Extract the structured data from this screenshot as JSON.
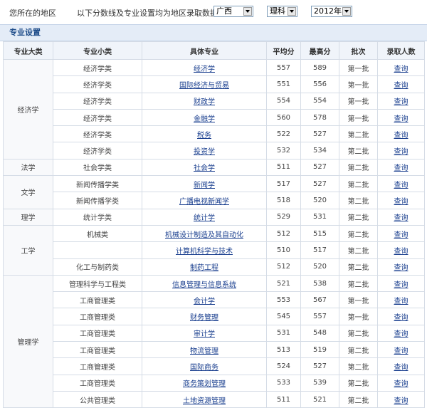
{
  "filters": {
    "region_label": "您所在的地区",
    "desc_label": "以下分数线及专业设置均为地区录取数据",
    "region": "广西",
    "type": "理科",
    "year": "2012年"
  },
  "section_title": "专业设置",
  "columns": [
    "专业大类",
    "专业小类",
    "具体专业",
    "平均分",
    "最高分",
    "批次",
    "录取人数"
  ],
  "groups": [
    {
      "name": "经济学",
      "rows": [
        {
          "sub": "经济学类",
          "major": "经济学",
          "avg": "557",
          "max": "589",
          "batch": "第一批",
          "query": "查询"
        },
        {
          "sub": "经济学类",
          "major": "国际经济与贸易",
          "avg": "551",
          "max": "556",
          "batch": "第一批",
          "query": "查询"
        },
        {
          "sub": "经济学类",
          "major": "财政学",
          "avg": "554",
          "max": "554",
          "batch": "第一批",
          "query": "查询"
        },
        {
          "sub": "经济学类",
          "major": "金融学",
          "avg": "560",
          "max": "578",
          "batch": "第一批",
          "query": "查询"
        },
        {
          "sub": "经济学类",
          "major": "税务",
          "avg": "522",
          "max": "527",
          "batch": "第二批",
          "query": "查询"
        },
        {
          "sub": "经济学类",
          "major": "投资学",
          "avg": "532",
          "max": "534",
          "batch": "第二批",
          "query": "查询"
        }
      ]
    },
    {
      "name": "法学",
      "rows": [
        {
          "sub": "社会学类",
          "major": "社会学",
          "avg": "511",
          "max": "527",
          "batch": "第二批",
          "query": "查询"
        }
      ]
    },
    {
      "name": "文学",
      "rows": [
        {
          "sub": "新闻传播学类",
          "major": "新闻学",
          "avg": "517",
          "max": "527",
          "batch": "第二批",
          "query": "查询"
        },
        {
          "sub": "新闻传播学类",
          "major": "广播电视新闻学",
          "avg": "518",
          "max": "520",
          "batch": "第二批",
          "query": "查询"
        }
      ]
    },
    {
      "name": "理学",
      "rows": [
        {
          "sub": "统计学类",
          "major": "统计学",
          "avg": "529",
          "max": "531",
          "batch": "第二批",
          "query": "查询"
        }
      ]
    },
    {
      "name": "工学",
      "rows": [
        {
          "sub": "机械类",
          "major": "机械设计制造及其自动化",
          "avg": "512",
          "max": "515",
          "batch": "第二批",
          "query": "查询"
        },
        {
          "sub": "",
          "major": "计算机科学与技术",
          "avg": "510",
          "max": "517",
          "batch": "第二批",
          "query": "查询"
        },
        {
          "sub": "化工与制药类",
          "major": "制药工程",
          "avg": "512",
          "max": "520",
          "batch": "第二批",
          "query": "查询"
        }
      ]
    },
    {
      "name": "管理学",
      "rows": [
        {
          "sub": "管理科学与工程类",
          "major": "信息管理与信息系统",
          "avg": "521",
          "max": "538",
          "batch": "第二批",
          "query": "查询"
        },
        {
          "sub": "工商管理类",
          "major": "会计学",
          "avg": "553",
          "max": "567",
          "batch": "第一批",
          "query": "查询"
        },
        {
          "sub": "工商管理类",
          "major": "财务管理",
          "avg": "545",
          "max": "557",
          "batch": "第一批",
          "query": "查询"
        },
        {
          "sub": "工商管理类",
          "major": "审计学",
          "avg": "531",
          "max": "548",
          "batch": "第二批",
          "query": "查询"
        },
        {
          "sub": "工商管理类",
          "major": "物流管理",
          "avg": "513",
          "max": "519",
          "batch": "第二批",
          "query": "查询"
        },
        {
          "sub": "工商管理类",
          "major": "国际商务",
          "avg": "524",
          "max": "527",
          "batch": "第二批",
          "query": "查询"
        },
        {
          "sub": "工商管理类",
          "major": "商务策划管理",
          "avg": "533",
          "max": "539",
          "batch": "第二批",
          "query": "查询"
        },
        {
          "sub": "公共管理类",
          "major": "土地资源管理",
          "avg": "511",
          "max": "521",
          "batch": "第二批",
          "query": "查询"
        }
      ]
    }
  ]
}
